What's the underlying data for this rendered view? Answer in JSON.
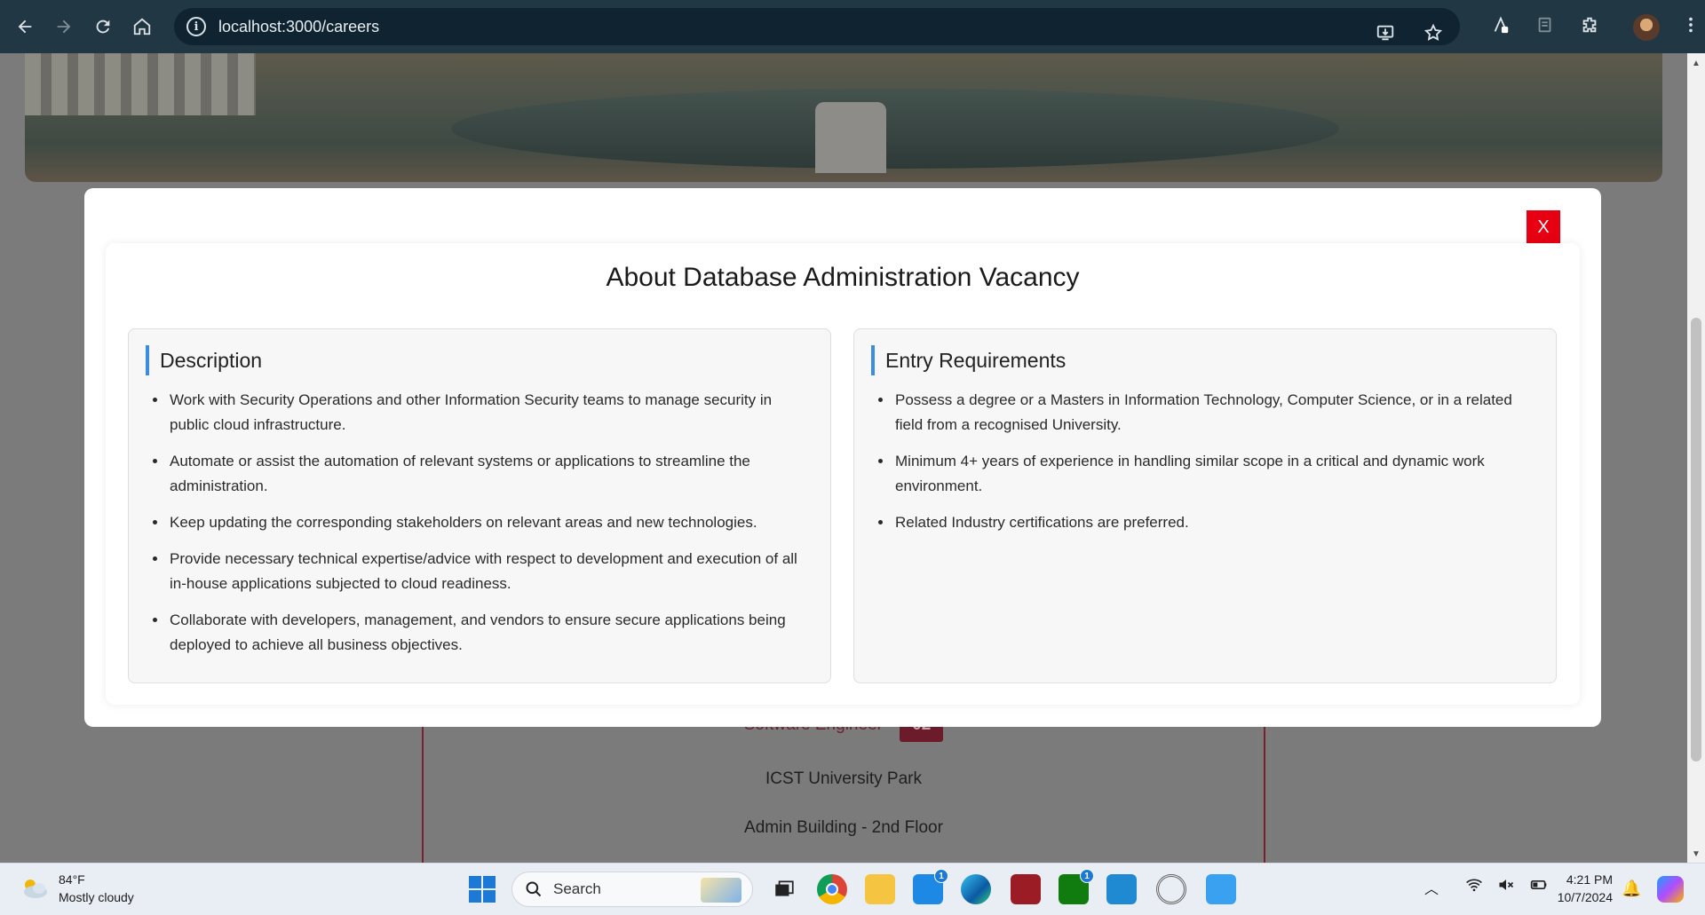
{
  "browser": {
    "url": "localhost:3000/careers",
    "back_label": "←",
    "forward_label": "→",
    "reload_label": "↻",
    "home_label": "⌂"
  },
  "page": {
    "below_card": {
      "role": "Software Engineer",
      "count": "02",
      "location_lines": [
        "ICST University Park",
        "Admin Building - 2nd Floor"
      ]
    }
  },
  "modal": {
    "close_label": "X",
    "title": "About Database Administration Vacancy",
    "description": {
      "heading": "Description",
      "items": [
        "Work with Security Operations and other Information Security teams to manage security in public cloud infrastructure.",
        "Automate or assist the automation of relevant systems or applications to streamline the administration.",
        "Keep updating the corresponding stakeholders on relevant areas and new technologies.",
        "Provide necessary technical expertise/advice with respect to development and execution of all in-house applications subjected to cloud readiness.",
        "Collaborate with developers, management, and vendors to ensure secure applications being deployed to achieve all business objectives."
      ]
    },
    "requirements": {
      "heading": "Entry Requirements",
      "items": [
        "Possess a degree or a Masters in Information Technology, Computer Science, or in a related field from a recognised University.",
        "Minimum 4+ years of experience in handling similar scope in a critical and dynamic work environment.",
        "Related Industry certifications are preferred."
      ]
    }
  },
  "taskbar": {
    "weather_temp": "84°F",
    "weather_desc": "Mostly cloudy",
    "search_label": "Search",
    "mail_badge": "1",
    "xbox_badge": "1",
    "time": "4:21 PM",
    "date": "10/7/2024"
  },
  "colors": {
    "chrome_bg": "#213743",
    "close_button": "#e60012",
    "accent_bar": "#3b8de0",
    "badge_bg": "#6b1b2a"
  }
}
